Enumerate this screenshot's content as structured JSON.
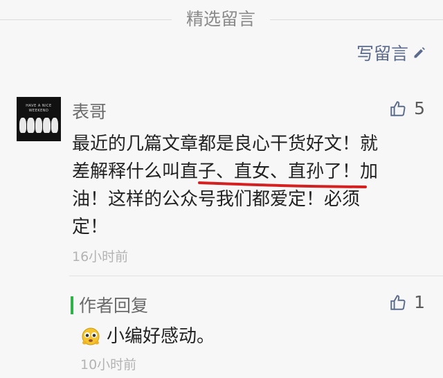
{
  "section": {
    "title": "精选留言"
  },
  "write_comment": {
    "label": "写留言"
  },
  "comment": {
    "avatar_text": "HAVE A NICE WEEKEND",
    "author": "表哥",
    "likes": "5",
    "text": "最近的几篇文章都是良心干货好文！就差解释什么叫直子、直女、直孙了！加油！这样的公众号我们都爱定！必须定！",
    "lines": [
      "最近的几篇文章都是良心干货好文！就",
      "差解释什么叫直子、直女、直孙了！加",
      "油！这样的公众号我们都爱定！必须",
      "定！"
    ],
    "time": "16小时前"
  },
  "reply": {
    "label": "作者回复",
    "likes": "1",
    "text": "小编好感动。",
    "time": "10小时前"
  },
  "colors": {
    "author_bar": "#2fb348",
    "underline": "#d32020",
    "link": "#5b6b8c"
  },
  "icons": {
    "write": "pencil-icon",
    "like": "thumbs-up-icon",
    "emoji": "moved-emoji-icon"
  }
}
